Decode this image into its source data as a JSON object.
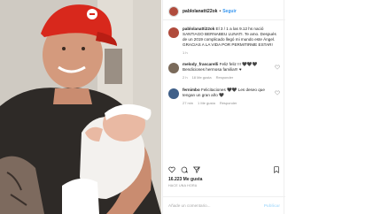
{
  "post": {
    "username": "pablolanatti22ok",
    "follow_label": "Seguir",
    "caption_user": "pablolanatti22ok",
    "caption_text": "El 3 / 1 a las 9.12 hs nació SANTIAGO BERNABEU LUNATI. Te amo. Después de un 2019 complicado llegó mi mundo este Ángel. GRACIAS A LA VIDA POR PERMITIRME ESTAR!",
    "caption_time": "1 h",
    "likes": "16.223 Me gusta",
    "timestamp": "HACE UNA HORA",
    "add_comment_placeholder": "Añade un comentario...",
    "publish_label": "Publicar"
  },
  "comments": [
    {
      "user": "melody_frascarelli",
      "text": "Feliz feliz !!! 🖤🖤🖤 Bendiciones hermosa familia!!! ♥",
      "time": "2 h",
      "likes": "18 Me gusta",
      "reply": "Responder",
      "avatar_color": "#7a6a5a"
    },
    {
      "user": "fernimbo",
      "text": "Felicitaciones 🖤🖤 Les deseo que tengan un gran año 🖤",
      "time": "27 min",
      "likes": "1 Me gusta",
      "reply": "Responder",
      "avatar_color": "#3f5f88"
    }
  ],
  "colors": {
    "link_blue": "#3897f0",
    "meta_gray": "#8e8e8e",
    "text": "#262626",
    "border": "#efefef"
  },
  "icons": {
    "like": "heart-icon",
    "comment": "comment-icon",
    "share": "share-icon",
    "save": "bookmark-icon"
  }
}
